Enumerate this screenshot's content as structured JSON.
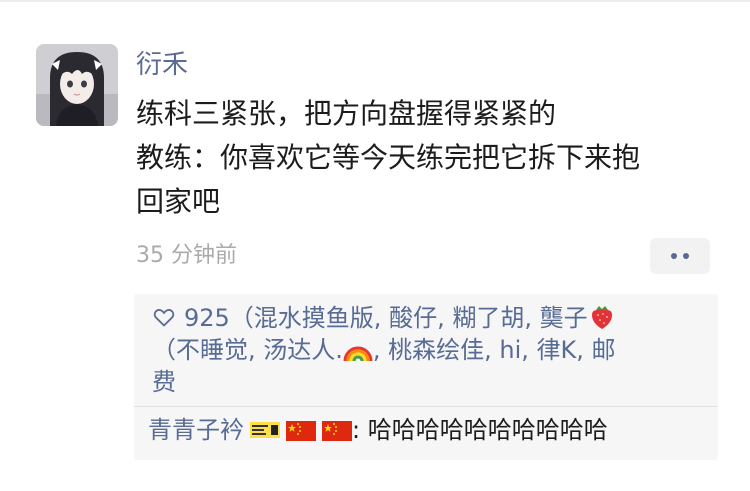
{
  "post": {
    "author": "衍禾",
    "lines": [
      "练科三紧张，把方向盘握得紧紧的",
      "教练：你喜欢它等今天练完把它拆下来抱",
      "回家吧"
    ],
    "timestamp": "35 分钟前"
  },
  "icons": {
    "more": "more-dots-icon",
    "like": "heart-icon",
    "strawberry": "strawberry-emoji-icon",
    "rainbow": "rainbow-emoji-icon",
    "ticket": "ticket-sticker-icon",
    "flag": "china-flag-icon"
  },
  "likes": {
    "line1_text": "925（混水摸鱼版, 酸仔, 糊了胡, 龑子",
    "line2_text": "（不睡觉, 汤达人.",
    "line2_rest": ", 桃森绘佳, hi, 律K, 邮",
    "line3_text": "费"
  },
  "comment": {
    "user": "青青子衿",
    "text": ": 哈哈哈哈哈哈哈哈哈哈"
  },
  "colors": {
    "link": "#576b95",
    "text": "#1c1c1c",
    "timestamp": "#aaaaaa",
    "box_bg": "#f6f6f6"
  }
}
